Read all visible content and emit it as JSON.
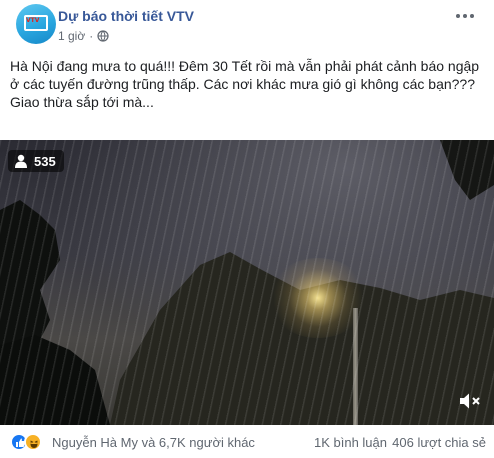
{
  "post": {
    "page_name": "Dự báo thời tiết VTV",
    "logo_text": "VTV",
    "time": "1 giờ",
    "separator": "·",
    "privacy_icon": "globe-icon",
    "more_icon": "more-options-icon",
    "text_lines": [
      "Hà Nội đang mưa to quá!!! Đêm 30 Tết rồi mà vẫn phải phát cảnh báo ngập ở các tuyến đường trũng thấp. Các nơi khác mưa gió gì không các bạn???",
      "Giao thừa sắp tới mà..."
    ]
  },
  "video": {
    "viewer_count": "535",
    "viewer_icon": "user-icon",
    "volume_icon": "volume-muted-icon"
  },
  "footer": {
    "reactions": [
      "like-icon",
      "haha-icon"
    ],
    "reactor_text": "Nguyễn Hà My và 6,7K người khác",
    "comments": "1K bình luận",
    "shares": "406 lượt chia sẻ"
  },
  "colors": {
    "page_name": "#385898",
    "meta_text": "#606770",
    "like": "#1877f2",
    "haha": "#f7b125"
  }
}
